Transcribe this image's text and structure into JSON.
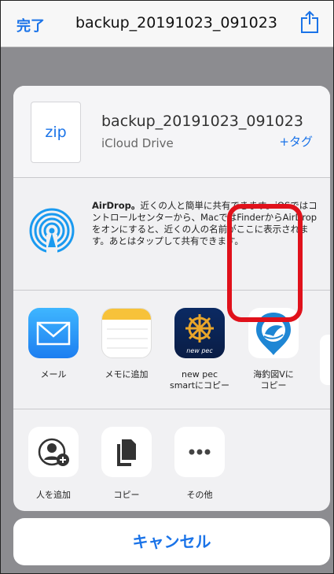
{
  "navbar": {
    "done_label": "完了",
    "title": "backup_20191023_091023",
    "share_icon": "share-icon"
  },
  "file": {
    "icon_text": "zip",
    "name": "backup_20191023_091023",
    "location": "iCloud Drive",
    "tag_label": "+タグ"
  },
  "airdrop": {
    "title": "AirDrop。",
    "description": "近くの人と簡単に共有できます。iOSではコントロールセンターから、MacではFinderからAirDropをオンにすると、近くの人の名前がここに表示されます。あとはタップして共有できます。"
  },
  "apps": [
    {
      "label": "メール",
      "icon": "mail-icon"
    },
    {
      "label": "メモに追加",
      "icon": "notes-icon"
    },
    {
      "label": "new pec\nsmartにコピー",
      "icon": "new-pec-icon",
      "icon_text": "new pec"
    },
    {
      "label": "海釣図Vに\nコピー",
      "icon": "kaichouzu-icon"
    }
  ],
  "actions": [
    {
      "label": "人を追加",
      "icon": "add-person-icon"
    },
    {
      "label": "コピー",
      "icon": "copy-icon"
    },
    {
      "label": "その他",
      "icon": "more-icon"
    }
  ],
  "cancel_label": "キャンセル",
  "colors": {
    "accent": "#1a73e8",
    "highlight": "#e0111b"
  }
}
